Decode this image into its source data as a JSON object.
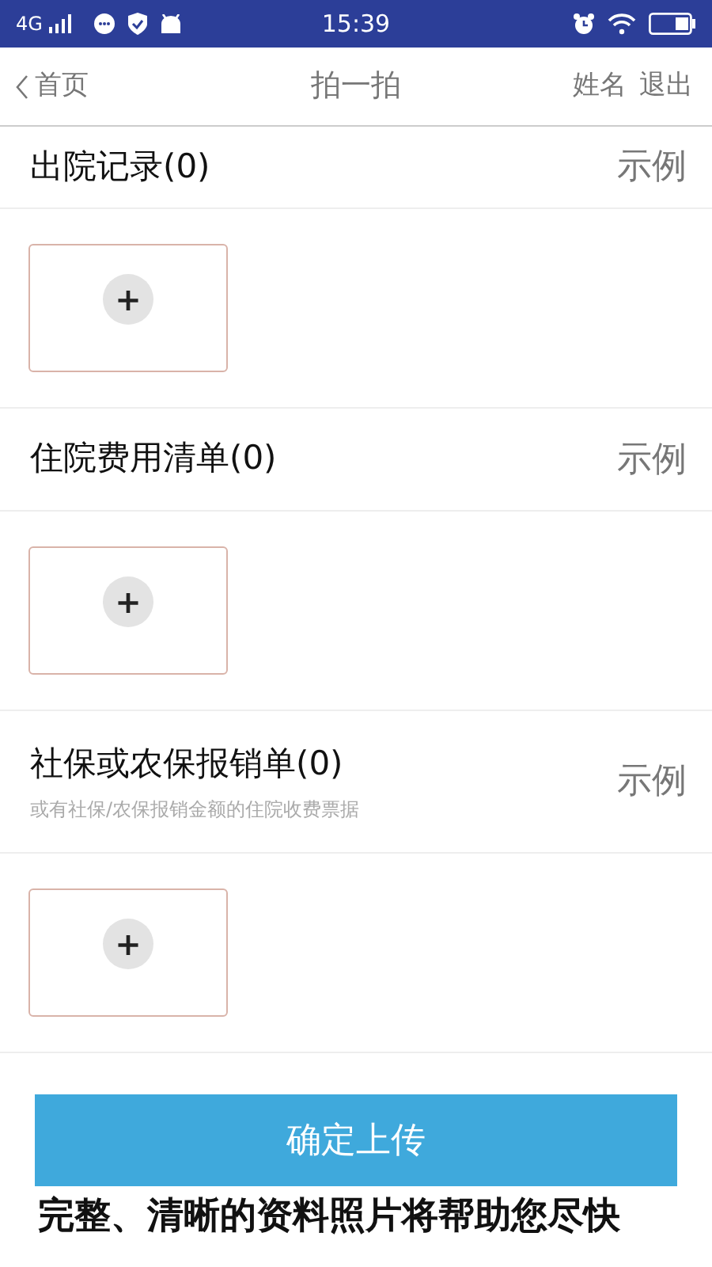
{
  "status_bar": {
    "network": "4G",
    "time": "15:39"
  },
  "nav": {
    "back": "首页",
    "title": "拍一拍",
    "user": "姓名",
    "logout": "退出"
  },
  "sections": [
    {
      "title": "出院记录(0)",
      "example": "示例",
      "add": "+"
    },
    {
      "title": "住院费用清单(0)",
      "example": "示例",
      "add": "+"
    },
    {
      "title": "社保或农保报销单(0)",
      "subtitle": "或有社保/农保报销金额的住院收费票据",
      "example": "示例",
      "add": "+"
    }
  ],
  "submit": "确定上传",
  "note": "完整、清晰的资料照片将帮助您尽快"
}
